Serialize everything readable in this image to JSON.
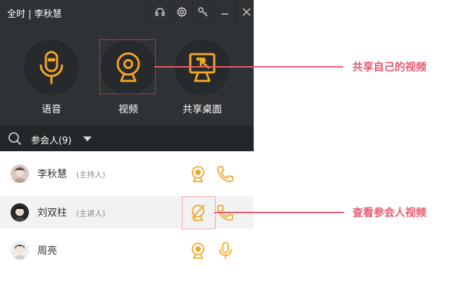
{
  "window": {
    "title": "全时 | 李秋慧"
  },
  "window_controls": [
    "headset-icon",
    "gear-icon",
    "tools-icon",
    "minimize-icon",
    "close-icon"
  ],
  "actions": [
    {
      "label": "语音",
      "icon": "microphone-icon"
    },
    {
      "label": "视频",
      "icon": "webcam-icon"
    },
    {
      "label": "共享桌面",
      "icon": "screen-share-icon"
    }
  ],
  "attendees": {
    "label": "参会人(9)",
    "items": [
      {
        "name": "李秋慧",
        "role": "(主持人)",
        "video": "webcam-icon",
        "audio": "phone-icon"
      },
      {
        "name": "刘双柱",
        "role": "(主讲人)",
        "video": "webcam-off-icon",
        "audio": "phone-icon"
      },
      {
        "name": "周亮",
        "role": "",
        "video": "webcam-icon",
        "audio": "microphone-icon"
      }
    ]
  },
  "annotations": {
    "share_own_video": "共享自己的视频",
    "view_attendee_video": "查看参会人视频"
  },
  "colors": {
    "accent": "#f5a623",
    "annotation": "#e85a6f",
    "panel": "#2f3235"
  }
}
